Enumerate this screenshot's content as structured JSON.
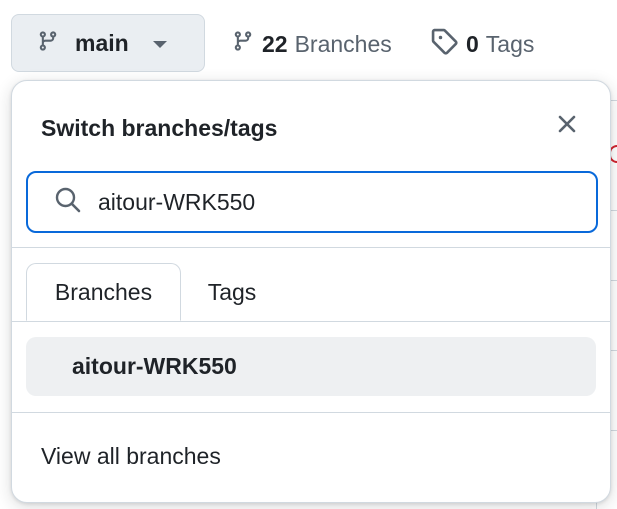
{
  "header": {
    "current_branch": "main",
    "branches_count": "22",
    "branches_label": "Branches",
    "tags_count": "0",
    "tags_label": "Tags"
  },
  "popover": {
    "title": "Switch branches/tags",
    "search": {
      "value": "aitour-WRK550",
      "placeholder": ""
    },
    "tabs": [
      {
        "label": "Branches",
        "active": true
      },
      {
        "label": "Tags",
        "active": false
      }
    ],
    "results": [
      {
        "label": "aitour-WRK550"
      }
    ],
    "footer_link": "View all branches"
  },
  "icons": {
    "branch": "git-branch-icon",
    "tag": "tag-icon",
    "search": "search-icon",
    "close": "close-icon",
    "caret": "triangle-down-icon"
  },
  "colors": {
    "accent": "#0969da",
    "text": "#1f2328",
    "muted": "#59636e",
    "border": "#d1d9e0",
    "button_bg": "#eaeef2",
    "selected_bg": "#eef0f2"
  }
}
